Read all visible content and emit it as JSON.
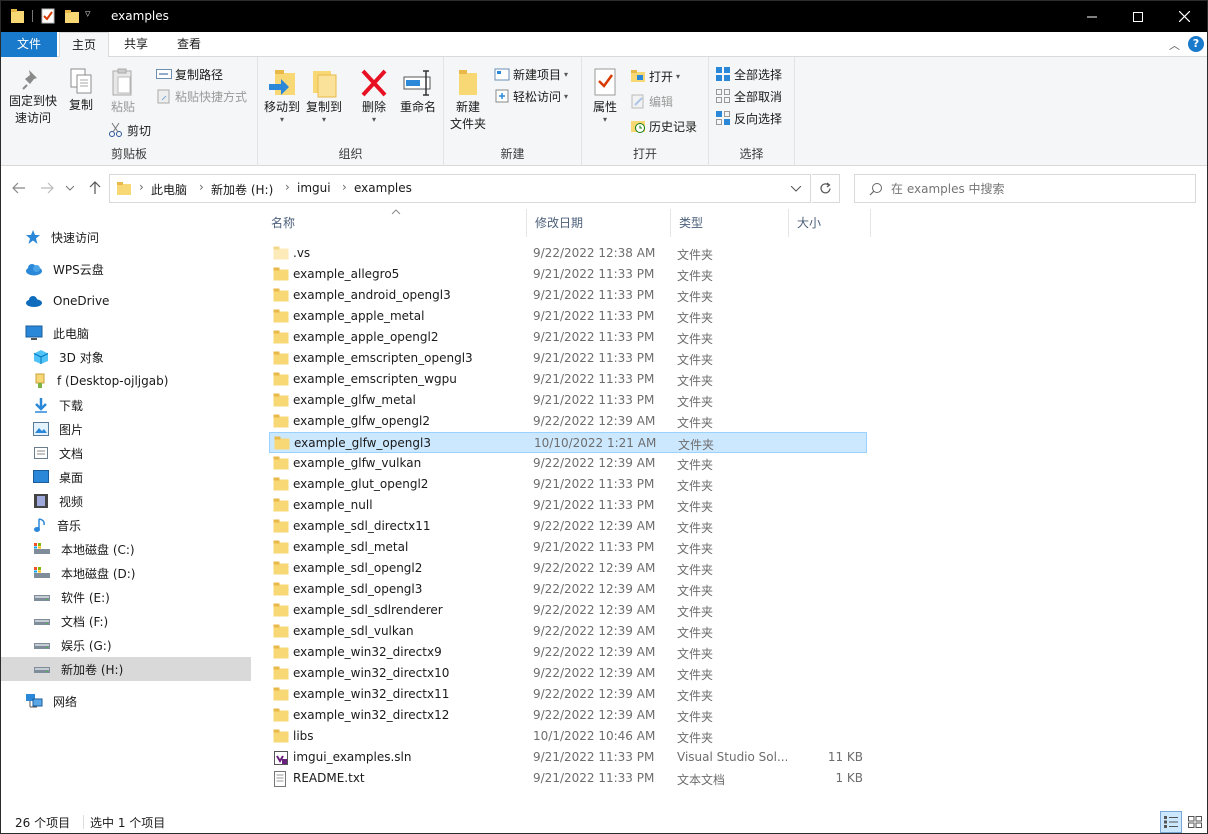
{
  "window": {
    "title": "examples"
  },
  "ribbon_tabs": {
    "file": "文件",
    "home": "主页",
    "share": "共享",
    "view": "查看"
  },
  "ribbon": {
    "clipboard": {
      "pin_line1": "固定到快",
      "pin_line2": "速访问",
      "copy": "复制",
      "paste": "粘贴",
      "copy_path": "复制路径",
      "paste_shortcut": "粘贴快捷方式",
      "cut": "剪切",
      "label": "剪贴板"
    },
    "organize": {
      "move_to": "移动到",
      "copy_to": "复制到",
      "delete": "删除",
      "rename": "重命名",
      "label": "组织"
    },
    "new": {
      "new_folder_line1": "新建",
      "new_folder_line2": "文件夹",
      "new_item": "新建项目",
      "easy_access": "轻松访问",
      "label": "新建"
    },
    "open": {
      "properties": "属性",
      "open": "打开",
      "edit": "编辑",
      "history": "历史记录",
      "label": "打开"
    },
    "select": {
      "select_all": "全部选择",
      "select_none": "全部取消",
      "invert": "反向选择",
      "label": "选择"
    }
  },
  "address": {
    "crumbs": [
      "此电脑",
      "新加卷 (H:)",
      "imgui",
      "examples"
    ]
  },
  "search": {
    "placeholder": "在 examples 中搜索"
  },
  "nav_pane": {
    "quick_access": "快速访问",
    "wps": "WPS云盘",
    "onedrive": "OneDrive",
    "this_pc": "此电脑",
    "children": [
      "3D 对象",
      "f (Desktop-ojljgab)",
      "下载",
      "图片",
      "文档",
      "桌面",
      "视频",
      "音乐",
      "本地磁盘 (C:)",
      "本地磁盘 (D:)",
      "软件 (E:)",
      "文档 (F:)",
      "娱乐 (G:)",
      "新加卷 (H:)"
    ],
    "network": "网络"
  },
  "columns": {
    "name": "名称",
    "date": "修改日期",
    "type": "类型",
    "size": "大小"
  },
  "files": [
    {
      "name": ".vs",
      "date": "9/22/2022 12:38 AM",
      "type": "文件夹",
      "size": ""
    },
    {
      "name": "example_allegro5",
      "date": "9/21/2022 11:33 PM",
      "type": "文件夹",
      "size": ""
    },
    {
      "name": "example_android_opengl3",
      "date": "9/21/2022 11:33 PM",
      "type": "文件夹",
      "size": ""
    },
    {
      "name": "example_apple_metal",
      "date": "9/21/2022 11:33 PM",
      "type": "文件夹",
      "size": ""
    },
    {
      "name": "example_apple_opengl2",
      "date": "9/21/2022 11:33 PM",
      "type": "文件夹",
      "size": ""
    },
    {
      "name": "example_emscripten_opengl3",
      "date": "9/21/2022 11:33 PM",
      "type": "文件夹",
      "size": ""
    },
    {
      "name": "example_emscripten_wgpu",
      "date": "9/21/2022 11:33 PM",
      "type": "文件夹",
      "size": ""
    },
    {
      "name": "example_glfw_metal",
      "date": "9/21/2022 11:33 PM",
      "type": "文件夹",
      "size": ""
    },
    {
      "name": "example_glfw_opengl2",
      "date": "9/22/2022 12:39 AM",
      "type": "文件夹",
      "size": ""
    },
    {
      "name": "example_glfw_opengl3",
      "date": "10/10/2022 1:21 AM",
      "type": "文件夹",
      "size": ""
    },
    {
      "name": "example_glfw_vulkan",
      "date": "9/22/2022 12:39 AM",
      "type": "文件夹",
      "size": ""
    },
    {
      "name": "example_glut_opengl2",
      "date": "9/21/2022 11:33 PM",
      "type": "文件夹",
      "size": ""
    },
    {
      "name": "example_null",
      "date": "9/21/2022 11:33 PM",
      "type": "文件夹",
      "size": ""
    },
    {
      "name": "example_sdl_directx11",
      "date": "9/22/2022 12:39 AM",
      "type": "文件夹",
      "size": ""
    },
    {
      "name": "example_sdl_metal",
      "date": "9/21/2022 11:33 PM",
      "type": "文件夹",
      "size": ""
    },
    {
      "name": "example_sdl_opengl2",
      "date": "9/22/2022 12:39 AM",
      "type": "文件夹",
      "size": ""
    },
    {
      "name": "example_sdl_opengl3",
      "date": "9/22/2022 12:39 AM",
      "type": "文件夹",
      "size": ""
    },
    {
      "name": "example_sdl_sdlrenderer",
      "date": "9/22/2022 12:39 AM",
      "type": "文件夹",
      "size": ""
    },
    {
      "name": "example_sdl_vulkan",
      "date": "9/22/2022 12:39 AM",
      "type": "文件夹",
      "size": ""
    },
    {
      "name": "example_win32_directx9",
      "date": "9/22/2022 12:39 AM",
      "type": "文件夹",
      "size": ""
    },
    {
      "name": "example_win32_directx10",
      "date": "9/22/2022 12:39 AM",
      "type": "文件夹",
      "size": ""
    },
    {
      "name": "example_win32_directx11",
      "date": "9/22/2022 12:39 AM",
      "type": "文件夹",
      "size": ""
    },
    {
      "name": "example_win32_directx12",
      "date": "9/22/2022 12:39 AM",
      "type": "文件夹",
      "size": ""
    },
    {
      "name": "libs",
      "date": "10/1/2022 10:46 AM",
      "type": "文件夹",
      "size": ""
    },
    {
      "name": "imgui_examples.sln",
      "date": "9/21/2022 11:33 PM",
      "type": "Visual Studio Sol...",
      "size": "11 KB"
    },
    {
      "name": "README.txt",
      "date": "9/21/2022 11:33 PM",
      "type": "文本文档",
      "size": "1 KB"
    }
  ],
  "status": {
    "count": "26 个项目",
    "selected": "选中 1 个项目"
  },
  "colors": {
    "accent": "#1979ca",
    "selection": "#cce8ff",
    "folder": "#f8d775"
  }
}
